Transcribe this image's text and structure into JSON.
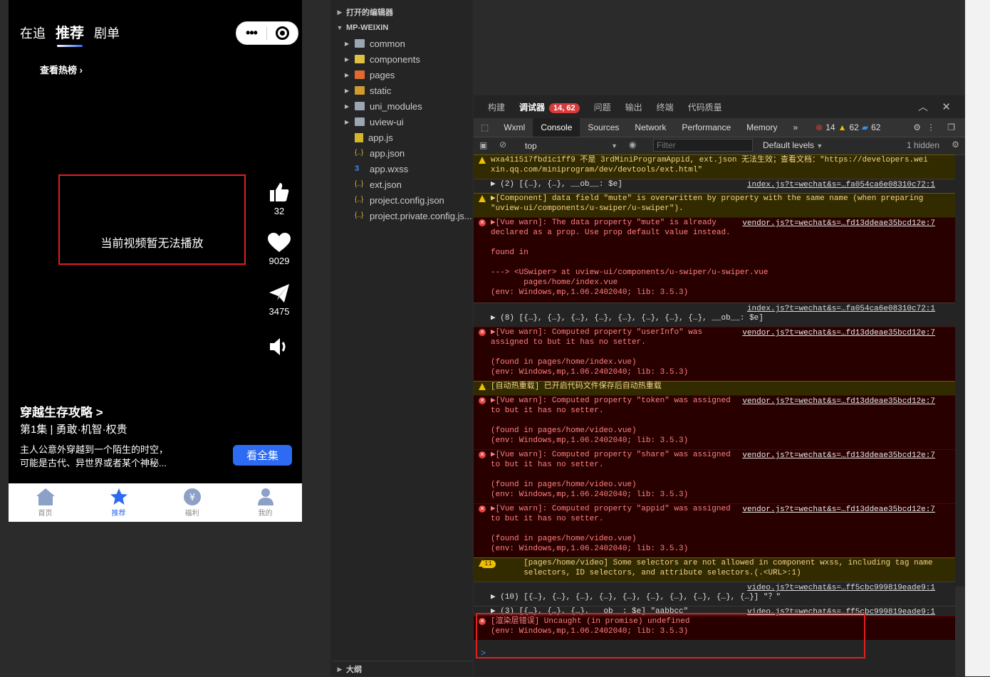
{
  "phone": {
    "top_tabs": [
      "在追",
      "推荐",
      "剧单"
    ],
    "hot_link": "查看热榜",
    "video_error": "当前视频暂无法播放",
    "likes": "32",
    "favorites": "9029",
    "shares": "3475",
    "show_title": "穿越生存攻略 >",
    "episode": "第1集 | 勇敢·机智·权贵",
    "description_line1": "主人公意外穿越到一个陌生的时空，",
    "description_line2": "可能是古代、异世界或者某个神秘...",
    "watch_all": "看全集",
    "tabbar": [
      "首页",
      "推荐",
      "福利",
      "我的"
    ]
  },
  "explorer": {
    "open_editors": "打开的编辑器",
    "project": "MP-WEIXIN",
    "folders": [
      "common",
      "components",
      "pages",
      "static",
      "uni_modules",
      "uview-ui"
    ],
    "files": [
      "app.js",
      "app.json",
      "app.wxss",
      "ext.json",
      "project.config.json",
      "project.private.config.js..."
    ],
    "outline": "大纲"
  },
  "devtools": {
    "top_tabs": [
      "构建",
      "调试器",
      "问题",
      "输出",
      "终端",
      "代码质量"
    ],
    "debugger_badge": "14, 62",
    "panel_tabs": [
      "Wxml",
      "Console",
      "Sources",
      "Network",
      "Performance",
      "Memory"
    ],
    "more_tabs": "»",
    "error_count": "14",
    "warn_count": "62",
    "info_count": "62",
    "context": "top",
    "filter_placeholder": "Filter",
    "levels": "Default levels",
    "hidden": "1 hidden",
    "logs": [
      {
        "type": "warn",
        "text": "wxa411517fbd1c1ff9 不是 3rdMiniProgramAppid, ext.json 无法生效；查看文档：\"https://developers.wei\nxin.qq.com/miniprogram/dev/devtools/ext.html\"",
        "src": ""
      },
      {
        "type": "info",
        "text": "▶ (2) [{…}, {…}, __ob__: $e]",
        "src": "index.js?t=wechat&s=…fa054ca6e08310c72:1"
      },
      {
        "type": "warn",
        "text": "▶[Component] data field \"mute\" is overwritten by property with the same name (when preparing\n\"uview-ui/components/u-swiper/u-swiper\").",
        "src": ""
      },
      {
        "type": "err",
        "text": "▶[Vue warn]: The data property \"mute\" is already\ndeclared as a prop. Use prop default value instead.\n\nfound in\n\n---> <USwiper> at uview-ui/components/u-swiper/u-swiper.vue\n       pages/home/index.vue\n(env: Windows,mp,1.06.2402040; lib: 3.5.3)",
        "src": "vendor.js?t=wechat&s=…fd13ddeae35bcd12e:7"
      },
      {
        "type": "info",
        "text": "\n▶ (8) [{…}, {…}, {…}, {…}, {…}, {…}, {…}, {…}, __ob__: $e]",
        "src": "index.js?t=wechat&s=…fa054ca6e08310c72:1"
      },
      {
        "type": "err",
        "text": "▶[Vue warn]: Computed property \"userInfo\" was\nassigned to but it has no setter.\n\n(found in pages/home/index.vue)\n(env: Windows,mp,1.06.2402040; lib: 3.5.3)",
        "src": "vendor.js?t=wechat&s=…fd13ddeae35bcd12e:7"
      },
      {
        "type": "warn",
        "text": "[自动热重载] 已开启代码文件保存后自动热重载",
        "src": ""
      },
      {
        "type": "err",
        "text": "▶[Vue warn]: Computed property \"token\" was assigned\nto but it has no setter.\n\n(found in pages/home/video.vue)\n(env: Windows,mp,1.06.2402040; lib: 3.5.3)",
        "src": "vendor.js?t=wechat&s=…fd13ddeae35bcd12e:7"
      },
      {
        "type": "err",
        "text": "▶[Vue warn]: Computed property \"share\" was assigned\nto but it has no setter.\n\n(found in pages/home/video.vue)\n(env: Windows,mp,1.06.2402040; lib: 3.5.3)",
        "src": "vendor.js?t=wechat&s=…fd13ddeae35bcd12e:7"
      },
      {
        "type": "err",
        "text": "▶[Vue warn]: Computed property \"appid\" was assigned\nto but it has no setter.\n\n(found in pages/home/video.vue)\n(env: Windows,mp,1.06.2402040; lib: 3.5.3)",
        "src": "vendor.js?t=wechat&s=…fd13ddeae35bcd12e:7"
      },
      {
        "type": "warn",
        "text": "       [pages/home/video] Some selectors are not allowed in component wxss, including tag name\n       selectors, ID selectors, and attribute selectors.(.<URL>:1)",
        "src": "",
        "count": "11"
      },
      {
        "type": "info",
        "text": "\n▶ (10) [{…}, {…}, {…}, {…}, {…}, {…}, {…}, {…}, {…}, {…}] \"？\"",
        "src": "video.js?t=wechat&s=…ff5cbc999819eade9:1"
      },
      {
        "type": "info",
        "text": "▶ (3) [{…}, {…}, {…}, __ob__: $e] \"aabbcc\"",
        "src": "video.js?t=wechat&s=…ff5cbc999819eade9:1"
      },
      {
        "type": "err",
        "text": "[渲染层错误] Uncaught (in promise) undefined\n(env: Windows,mp,1.06.2402040; lib: 3.5.3)",
        "src": ""
      }
    ],
    "prompt": ">"
  }
}
